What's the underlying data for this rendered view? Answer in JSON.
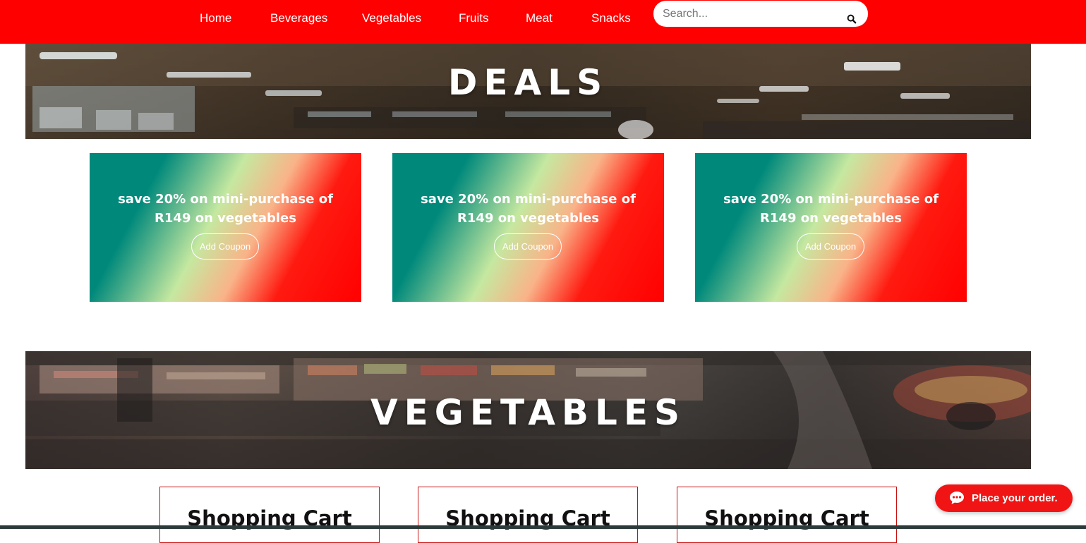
{
  "nav": {
    "links": [
      "Home",
      "Beverages",
      "Vegetables",
      "Fruits",
      "Meat",
      "Snacks"
    ],
    "search_placeholder": "Search...",
    "background_color": "#fe0000",
    "search_icon": "search-icon"
  },
  "deals": {
    "title": "DEALS",
    "cards": [
      {
        "text": "save 20% on mini-purchase of R149 on vegetables",
        "button": "Add Coupon"
      },
      {
        "text": "save 20% on mini-purchase of R149 on vegetables",
        "button": "Add Coupon"
      },
      {
        "text": "save 20% on mini-purchase of R149 on vegetables",
        "button": "Add Coupon"
      }
    ],
    "gradient_colors": [
      "#00897b",
      "#c5e8a0",
      "#ff0000"
    ]
  },
  "vegetables": {
    "title": "VEGETABLES",
    "carts": [
      {
        "title": "Shopping Cart"
      },
      {
        "title": "Shopping Cart"
      },
      {
        "title": "Shopping Cart"
      }
    ]
  },
  "order_widget": {
    "label": "Place your order.",
    "icon": "chat-bubble-icon",
    "color": "#f01414"
  }
}
